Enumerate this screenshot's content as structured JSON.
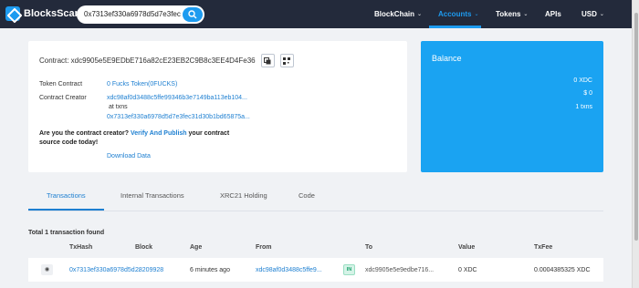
{
  "header": {
    "brand": "BlocksScan",
    "search_value": "0x7313ef330a6978d5d7e3fec",
    "nav": [
      {
        "label": "BlockChain",
        "caret": "⌄"
      },
      {
        "label": "Accounts",
        "caret": "⌄"
      },
      {
        "label": "Tokens",
        "caret": "⌄"
      },
      {
        "label": "APIs",
        "caret": ""
      },
      {
        "label": "USD",
        "caret": "⌄"
      }
    ]
  },
  "contract": {
    "heading": "Contract: xdc9905e5E9EDbE716a82cE23EB2C9B8c3EE4D4Fe36",
    "copy_icon": "copy-icon",
    "qr_icon": "qr-code-icon",
    "token_label": "Token Contract",
    "token_value": "0 Fucks Token(0FUCKS)",
    "creator_label": "Contract Creator",
    "creator_address": "xdc98af0d3488c5ffe99346b3e7149ba113eb104...",
    "creator_at": "at txns",
    "creator_txn": "0x7313ef330a6978d5d7e3fec31d30b1bd65875a...",
    "prompt_lead": "Are you the contract creator?",
    "prompt_link": "Verify And Publish",
    "prompt_tail": "your contract source code today!",
    "download": "Download Data"
  },
  "balance": {
    "title": "Balance",
    "xdc": "0 XDC",
    "usd": "$ 0",
    "txns": "1 txns"
  },
  "tabs": [
    "Transactions",
    "Internal Transactions",
    "XRC21 Holding",
    "Code"
  ],
  "table": {
    "found": "Total 1 transaction found",
    "columns": [
      "TxHash",
      "Block",
      "Age",
      "From",
      "To",
      "Value",
      "TxFee"
    ],
    "rows": [
      {
        "txhash": "0x7313ef330a6978d5d...",
        "block": "28209928",
        "age": "6 minutes ago",
        "from": "xdc98af0d3488c5ffe9...",
        "direction": "IN",
        "to": "xdc9905e5e9edbe716...",
        "value": "0 XDC",
        "txfee": "0.0004385325 XDC"
      }
    ]
  },
  "colors": {
    "header_bg": "#232a3b",
    "accent": "#1d9bf0",
    "link": "#1d7fd1",
    "balance_bg": "#1aa3f2",
    "in_badge": "#19a06b"
  }
}
